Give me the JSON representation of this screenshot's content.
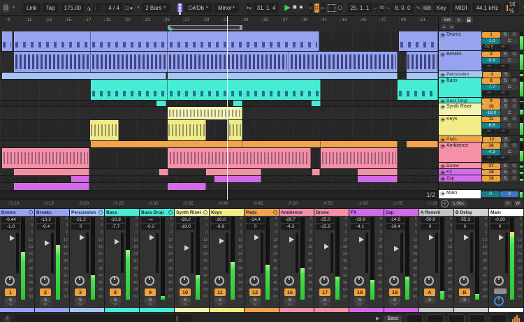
{
  "toolbar": {
    "link": "Link",
    "tap": "Tap",
    "tempo": "175.00",
    "time_signature": "4 / 4",
    "quantization": "2 Bars",
    "scale_root": "C#/Db",
    "scale_mode": "Minor",
    "arrangement_position": "31. 1. 4",
    "loop_start": "25. 1. 1",
    "loop_length": "8. 0. 0",
    "key_label": "Key",
    "midi_label": "MIDI",
    "sample_rate": "44.1 kHz",
    "cpu_load": "16 %"
  },
  "arrangement": {
    "bar_numbers": [
      "9",
      "11",
      "13",
      "15",
      "17",
      "19",
      "21",
      "23",
      "25",
      "27",
      "29",
      "31",
      "33",
      "35",
      "37",
      "39",
      "41",
      "43",
      "45",
      "47",
      "49",
      "51"
    ],
    "time_labels": [
      "0:10",
      "0:15",
      "0:20",
      "0:25",
      "0:30",
      "0:35",
      "0:40",
      "0:45",
      "0:50",
      "0:55",
      "1:00",
      "1:05",
      "1:10"
    ],
    "loop": {
      "start_pct": 38.2,
      "width_pct": 17.1
    },
    "playhead_pct": 51.8,
    "half_label": "1/2"
  },
  "header_panel": {
    "set": "Set",
    "zoom": "1.00x",
    "h": "H",
    "w": "W"
  },
  "scale_ticks": [
    "6",
    "0",
    "6",
    "12",
    "18",
    "24",
    "30",
    "36",
    "42",
    "48",
    "54",
    "60"
  ],
  "solo_label": "S",
  "pan_center": "C",
  "tracks": [
    {
      "name": "Drums",
      "num": "1",
      "color": "#96a3f0",
      "height": 28,
      "texture": "midi",
      "vol": "-1.0",
      "vol_db": -1.0,
      "pan": "C",
      "out_meters": [
        "-52.8",
        "-∞"
      ],
      "meters_hot": true,
      "peak": "-6.44",
      "meter": 58,
      "arm": true,
      "tab_circle": true,
      "clips": [
        [
          0.5,
          2.8
        ],
        [
          3.2,
          20.7
        ],
        [
          20.7,
          38.2
        ],
        [
          38.2,
          72.9
        ],
        [
          91.1,
          100
        ]
      ]
    },
    {
      "name": "Breaks",
      "num": "2",
      "color": "#96a3f0",
      "height": 29,
      "texture": "dense",
      "vol": "-9.4",
      "vol_db": -9.4,
      "pan": "C",
      "out_meters": [
        "-∞",
        "-∞"
      ],
      "meters_hot": false,
      "peak": "-10.2",
      "meter": 66,
      "arm": true,
      "tab_circle": false,
      "clips": [
        [
          3.2,
          20.7
        ],
        [
          20.7,
          38.2
        ],
        [
          38.2,
          66.0
        ],
        [
          66.0,
          90.8
        ],
        [
          92.8,
          100
        ]
      ]
    },
    {
      "name": "Percussion",
      "num": "3",
      "color": "#a4c6f5",
      "height": 9,
      "texture": "none",
      "vol": "0",
      "vol_db": 0,
      "peak": "-21.2",
      "meter": 30,
      "arm": true,
      "header_arm": false,
      "tab_circle": true,
      "clips": [
        [
          0.5,
          37.9
        ],
        [
          38.2,
          90.8
        ],
        [
          92.8,
          100
        ]
      ]
    },
    {
      "name": "Bass",
      "num": "8",
      "color": "#47ecd4",
      "height": 29,
      "texture": "midi",
      "vol": "-7.7",
      "vol_db": -7.7,
      "pan": "C",
      "out_meters": [
        "-∞",
        "-∞"
      ],
      "meters_hot": false,
      "peak": "-10.8",
      "meter": 60,
      "arm": true,
      "tab_circle": false,
      "clips": [
        [
          20.7,
          38.2
        ],
        [
          38.2,
          73.2
        ],
        [
          90.8,
          100
        ]
      ]
    },
    {
      "name": "Bass Drop",
      "num": "9",
      "color": "#47ecd4",
      "height": 8,
      "texture": "none",
      "vol": "-0.2",
      "vol_db": -0.2,
      "peak": "-∞",
      "meter": 4,
      "arm": true,
      "header_arm": true,
      "tab_circle": true,
      "clips": [
        [
          35.8,
          37.9
        ],
        [
          53.3,
          55.4
        ],
        [
          71.2,
          73.2
        ]
      ]
    },
    {
      "name": "Synth Riser",
      "num": "10",
      "color": "#f3f4b0",
      "height": 18,
      "texture": "wave",
      "vol": "-18.0",
      "vol_db": -18.0,
      "pan": "C",
      "peak": "-28.2",
      "meter": 30,
      "arm": true,
      "header_arm": true,
      "tab_circle": true,
      "clips": [
        [
          38.2,
          55.4
        ]
      ]
    },
    {
      "name": "Keys",
      "num": "11",
      "color": "#f1ec83",
      "height": 29,
      "texture": "wave",
      "vol": "-6.6",
      "vol_db": -6.6,
      "pan": "C",
      "out_meters": [
        "-∞",
        "-∞"
      ],
      "meters_hot": false,
      "peak": "-16.0",
      "meter": 46,
      "arm": true,
      "tab_circle": false,
      "clips": [
        [
          20.5,
          27.1
        ],
        [
          38.2,
          47.0
        ],
        [
          52.1,
          55.4
        ]
      ]
    },
    {
      "name": "Pads",
      "num": "12",
      "color": "#f2a44c",
      "height": 9,
      "texture": "none",
      "vol": "0",
      "vol_db": 0,
      "peak": "-14.4",
      "meter": 42,
      "arm": true,
      "header_arm": false,
      "tab_circle": true,
      "clips": [
        [
          20.7,
          55.4
        ],
        [
          55.4,
          73.2
        ],
        [
          73.2,
          90.8
        ],
        [
          92.8,
          100
        ]
      ]
    },
    {
      "name": "Ambience",
      "num": "16",
      "color": "#f590a6",
      "height": 29,
      "texture": "wave",
      "vol": "-4.3",
      "vol_db": -4.3,
      "pan": "C",
      "out_meters": [
        "-∞",
        "-∞"
      ],
      "meters_hot": false,
      "peak": "-29.7",
      "meter": 38,
      "arm": true,
      "tab_circle": false,
      "clips": [
        [
          0.5,
          20.4
        ],
        [
          38.2,
          70.9
        ],
        [
          73.2,
          90.8
        ]
      ]
    },
    {
      "name": "Drone",
      "num": "17",
      "color": "#f590a6",
      "height": 9,
      "texture": "none",
      "vol": "-15.6",
      "vol_db": -15.6,
      "peak": "-25.0",
      "meter": 28,
      "arm": true,
      "header_arm": true,
      "tab_circle": false,
      "clips": [
        [
          3.2,
          20.4
        ],
        [
          36.3,
          38.5
        ],
        [
          47.0,
          59.7
        ],
        [
          71.3,
          73.0
        ],
        [
          81.7,
          90.8
        ]
      ]
    },
    {
      "name": "FX",
      "num": "18",
      "color": "#d26be8",
      "height": 9,
      "texture": "none",
      "vol": "-4.1",
      "vol_db": -4.1,
      "peak": "-19.6",
      "meter": 24,
      "arm": true,
      "header_arm": true,
      "tab_circle": false,
      "clips": [
        [
          16.2,
          20.4
        ],
        [
          48.9,
          59.7
        ],
        [
          81.7,
          90.8
        ]
      ]
    },
    {
      "name": "Zap",
      "num": "19",
      "color": "#d26be8",
      "height": 10,
      "texture": "none",
      "vol": "-19.4",
      "vol_db": -19.4,
      "peak": "-24.6",
      "meter": 28,
      "arm": true,
      "header_arm": true,
      "tab_circle": false,
      "clips": [
        [
          3.2,
          20.4
        ],
        [
          38.2,
          47.0
        ]
      ]
    }
  ],
  "returns": [
    {
      "name": "A Reverb",
      "badge": "A",
      "color": "#c6c6c6",
      "peak": "-50.9",
      "vol": "0",
      "vol_db": 0,
      "meter": 10
    },
    {
      "name": "B Delay",
      "badge": "B",
      "color": "#d2d2d2",
      "peak": "-55.3",
      "vol": "0",
      "vol_db": 0,
      "meter": 7
    }
  ],
  "main": {
    "name": "Main",
    "color": "#ffffff",
    "box1": "0",
    "box2": "0",
    "peak": "-0.30",
    "vol": "0",
    "vol_db": 0,
    "meter": 82
  },
  "status": {
    "device_track": "Bass"
  }
}
